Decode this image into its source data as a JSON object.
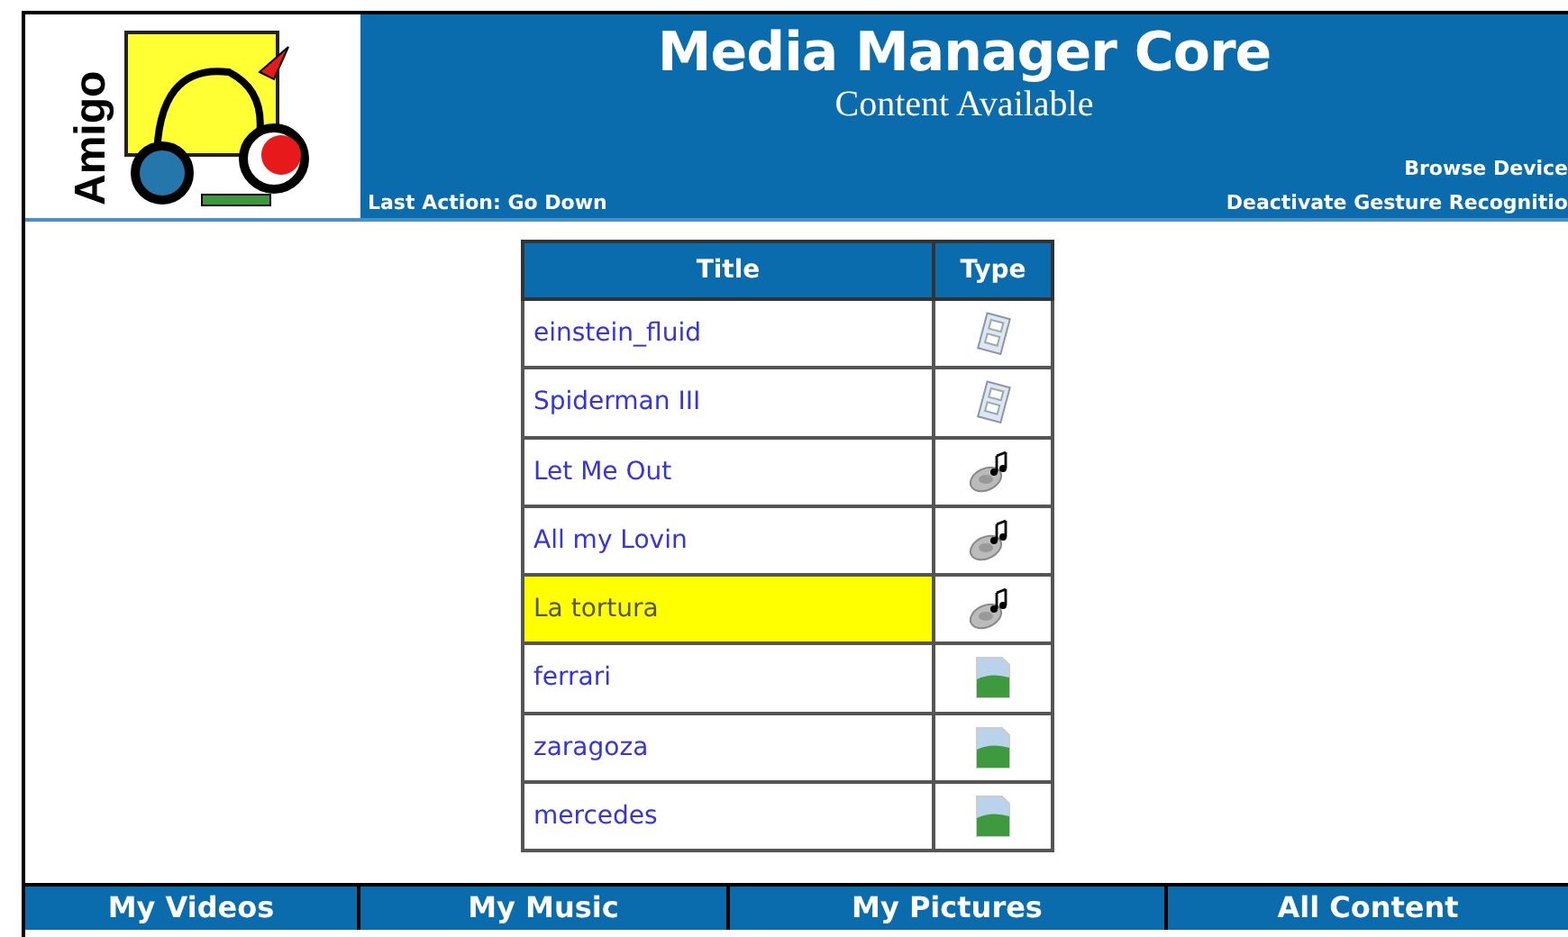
{
  "header": {
    "logo_text": "Amigo",
    "title": "Media Manager Core",
    "subtitle": "Content Available",
    "last_action": "Last Action: Go Down",
    "links": [
      "Browse Device",
      "Deactivate Gesture Recognitio"
    ]
  },
  "table": {
    "columns": [
      "Title",
      "Type"
    ],
    "rows": [
      {
        "title": "einstein_fluid",
        "kind": "video",
        "selected": false
      },
      {
        "title": "Spiderman III",
        "kind": "video",
        "selected": false
      },
      {
        "title": "Let Me Out",
        "kind": "audio",
        "selected": false
      },
      {
        "title": "All my Lovin",
        "kind": "audio",
        "selected": false
      },
      {
        "title": "La tortura",
        "kind": "audio",
        "selected": true
      },
      {
        "title": "ferrari",
        "kind": "image",
        "selected": false
      },
      {
        "title": "zaragoza",
        "kind": "image",
        "selected": false
      },
      {
        "title": "mercedes",
        "kind": "image",
        "selected": false
      }
    ]
  },
  "tabs": [
    "My Videos",
    "My Music",
    "My Pictures",
    "All Content"
  ]
}
